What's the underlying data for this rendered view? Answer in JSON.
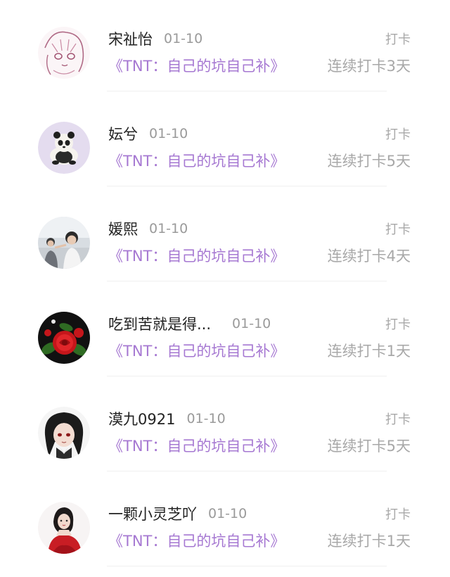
{
  "feed": {
    "entries": [
      {
        "username": "宋祉怡",
        "date": "01-10",
        "checkin_label": "打卡",
        "circle": "《TNT：自己的坑自己补》",
        "streak": "连续打卡3天",
        "avatar_icon": "anime-girl-sketch-avatar"
      },
      {
        "username": "妘兮",
        "date": "01-10",
        "checkin_label": "打卡",
        "circle": "《TNT：自己的坑自己补》",
        "streak": "连续打卡5天",
        "avatar_icon": "panda-plush-avatar"
      },
      {
        "username": "媛熙",
        "date": "01-10",
        "checkin_label": "打卡",
        "circle": "《TNT：自己的坑自己补》",
        "streak": "连续打卡4天",
        "avatar_icon": "photo-people-avatar"
      },
      {
        "username": "吃到苦就是得...",
        "date": "01-10",
        "checkin_label": "打卡",
        "circle": "《TNT：自己的坑自己补》",
        "streak": "连续打卡1天",
        "avatar_icon": "red-rose-avatar"
      },
      {
        "username": "漠九0921",
        "date": "01-10",
        "checkin_label": "打卡",
        "circle": "《TNT：自己的坑自己补》",
        "streak": "连续打卡5天",
        "avatar_icon": "anime-boy-avatar"
      },
      {
        "username": "一颗小灵芝吖",
        "date": "01-10",
        "checkin_label": "打卡",
        "circle": "《TNT：自己的坑自己补》",
        "streak": "连续打卡1天",
        "avatar_icon": "red-dress-woman-avatar"
      }
    ]
  },
  "colors": {
    "username": "#222222",
    "meta": "#9a9a9a",
    "circle_link": "#a678d2",
    "streak": "#a8a8a8",
    "divider": "#f0f0f0"
  }
}
